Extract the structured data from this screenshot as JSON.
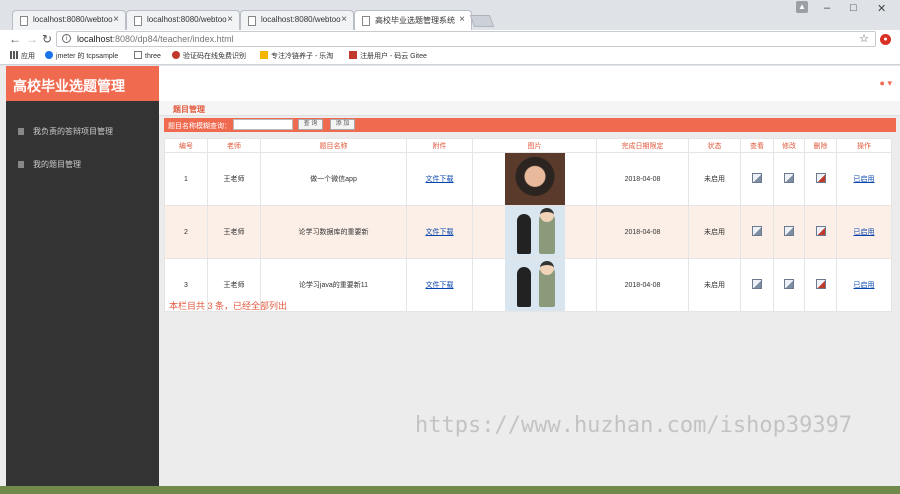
{
  "browser": {
    "tabs": [
      {
        "label": "localhost:8080/webtoo"
      },
      {
        "label": "localhost:8080/webtoo"
      },
      {
        "label": "localhost:8080/webtoo"
      },
      {
        "label": "高校毕业选题管理系统"
      }
    ],
    "url_host": "localhost",
    "url_rest": ":8080/dp84/teacher/index.html",
    "bookmarks": [
      {
        "label": "应用"
      },
      {
        "label": "jmeter 的 tcpsample"
      },
      {
        "label": "three"
      },
      {
        "label": "验证码在线免费识别"
      },
      {
        "label": "专注冷链养子 - 乐淘"
      },
      {
        "label": "注册用户 - 码云 Gitee"
      }
    ]
  },
  "app": {
    "brand": "高校毕业选题管理",
    "sidebar": [
      {
        "label": "我负责的答辩项目管理"
      },
      {
        "label": "我的题目管理"
      }
    ],
    "section_title": "题目管理",
    "search": {
      "label": "题目名称模糊查询：",
      "value": "",
      "query_label": "查 询",
      "add_label": "添 加"
    },
    "table": {
      "headers": [
        "编号",
        "老师",
        "题目名称",
        "附件",
        "图片",
        "完成日期限定",
        "状态",
        "查看",
        "修改",
        "删除",
        "操作"
      ],
      "rows": [
        {
          "id": "1",
          "teacher": "王老师",
          "title": "做一个微信app",
          "attachment": "文件下载",
          "image": "dark-portrait",
          "date": "2018-04-08",
          "status": "未启用",
          "action": "已启用"
        },
        {
          "id": "2",
          "teacher": "王老师",
          "title": "论学习数据库的重要新",
          "attachment": "文件下载",
          "image": "cartoon-pair",
          "date": "2018-04-08",
          "status": "未启用",
          "action": "已启用"
        },
        {
          "id": "3",
          "teacher": "王老师",
          "title": "论学习java的重要新11",
          "attachment": "文件下载",
          "image": "cartoon-pair",
          "date": "2018-04-08",
          "status": "未启用",
          "action": "已启用"
        }
      ]
    },
    "footer_note": "本栏目共 3 条，已经全部列出"
  },
  "watermark": "https://www.huzhan.com/ishop39397",
  "colors": {
    "accent": "#f06a50",
    "sidebar": "#333333",
    "link": "#0645ad"
  }
}
